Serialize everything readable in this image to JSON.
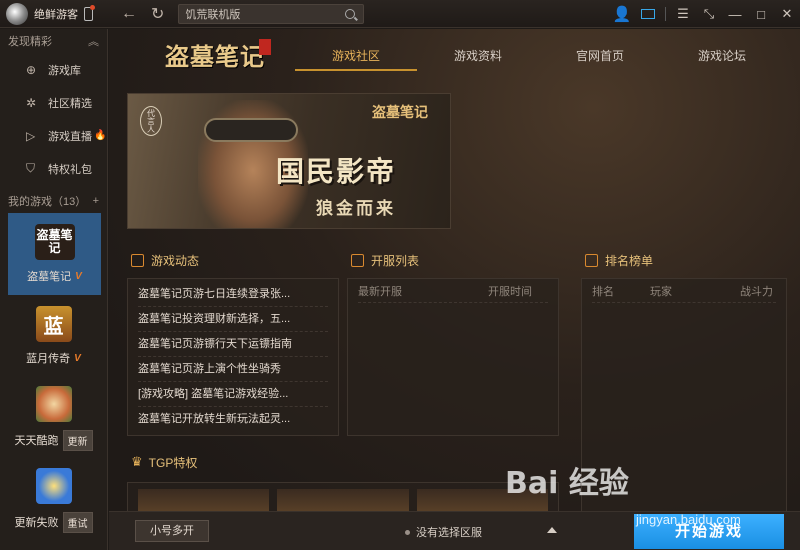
{
  "titlebar": {
    "username": "绝鲜游客",
    "search_value": "饥荒联机版",
    "back": "←",
    "refresh": "↻",
    "menu": "☰",
    "shrink": "⤡",
    "minimize": "—",
    "maximize": "□",
    "close": "✕"
  },
  "sidebar": {
    "discover_label": "发现精彩",
    "items": [
      {
        "label": "游戏库",
        "icon": "⊕"
      },
      {
        "label": "社区精选",
        "icon": "✲"
      },
      {
        "label": "游戏直播",
        "icon": "▷"
      },
      {
        "label": "特权礼包",
        "icon": "⛉"
      }
    ],
    "fire": "🔥",
    "my_games_label": "我的游戏（13）",
    "add": "+",
    "games": [
      {
        "name": "盗墓笔记",
        "logo": "盗墓笔记",
        "badge": "V"
      },
      {
        "name": "蓝月传奇",
        "logo": "蓝",
        "badge": "V"
      },
      {
        "name": "天天酷跑",
        "tag": "更新"
      },
      {
        "name": "更新失败",
        "tag": "重试"
      }
    ]
  },
  "main": {
    "brand": "盗墓笔记",
    "tabs": [
      "游戏社区",
      "游戏资料",
      "官网首页",
      "游戏论坛"
    ],
    "banner": {
      "title": "盗墓笔记",
      "slogan": "国民影帝",
      "sub": "狼金而来",
      "tag": "代言人"
    },
    "news": {
      "title": "游戏动态",
      "items": [
        "盗墓笔记页游七日连续登录张...",
        "盗墓笔记投资理财新选择，五...",
        "盗墓笔记页游镖行天下运镖指南",
        "盗墓笔记页游上演个性坐骑秀",
        "[游戏攻略] 盗墓笔记游戏经验...",
        "盗墓笔记开放转生新玩法起灵..."
      ]
    },
    "servers": {
      "title": "开服列表",
      "col_latest": "最新开服",
      "col_time": "开服时间"
    },
    "ranking": {
      "title": "排名榜单",
      "col_rank": "排名",
      "col_player": "玩家",
      "col_power": "战斗力"
    },
    "tgp": {
      "title": "TGP特权"
    }
  },
  "bottombar": {
    "small_account": "小号多开",
    "server_status": "没有选择区服",
    "start": "开始游戏"
  },
  "watermark": {
    "text": "Bai 经验",
    "url": "jingyan.baidu.com"
  }
}
